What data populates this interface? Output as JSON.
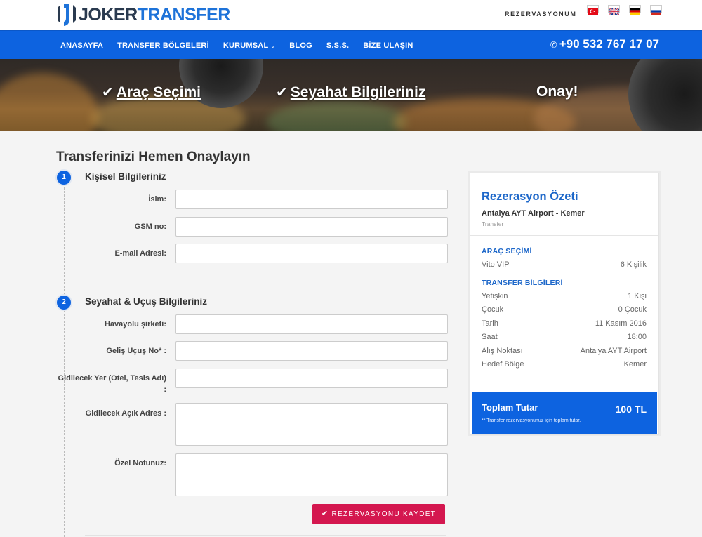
{
  "header": {
    "logo_part1": "JOKER",
    "logo_part2": "TRANSFER",
    "reservation_link": "REZERVASYONUM",
    "flags": [
      "turkish-flag-icon",
      "uk-flag-icon",
      "german-flag-icon",
      "russian-flag-icon"
    ]
  },
  "nav": {
    "items": [
      {
        "label": "ANASAYFA"
      },
      {
        "label": "TRANSFER BÖLGELERİ"
      },
      {
        "label": "KURUMSAL",
        "dropdown": true
      },
      {
        "label": "BLOG"
      },
      {
        "label": "S.S.S."
      },
      {
        "label": "BİZE ULAŞIN"
      }
    ],
    "phone": "+90 532 767 17 07"
  },
  "steps": [
    {
      "label": "Araç Seçimi",
      "done": true
    },
    {
      "label": "Seyahat Bilgileriniz",
      "done": true
    },
    {
      "label": "Onay!",
      "done": false
    }
  ],
  "form": {
    "title": "Transferinizi Hemen Onaylayın",
    "section1": {
      "num": "1",
      "title": "Kişisel Bilgileriniz",
      "fields": [
        {
          "label": "İsim:",
          "value": ""
        },
        {
          "label": "GSM no:",
          "value": ""
        },
        {
          "label": "E-mail Adresi:",
          "value": ""
        }
      ]
    },
    "section2": {
      "num": "2",
      "title": "Seyahat & Uçuş Bilgileriniz",
      "fields": [
        {
          "label": "Havayolu şirketi:",
          "value": ""
        },
        {
          "label": "Geliş Uçuş No* :",
          "value": ""
        },
        {
          "label": "Gidilecek Yer (Otel, Tesis Adı) :",
          "value": ""
        },
        {
          "label": "Gidilecek Açık Adres :",
          "value": ""
        },
        {
          "label": "Özel Notunuz:",
          "value": ""
        }
      ]
    },
    "save_label": "REZERVASYONU KAYDET"
  },
  "summary": {
    "title": "Rezerasyon Özeti",
    "route": "Antalya AYT Airport - Kemer",
    "type": "Transfer",
    "vehicle_heading": "ARAÇ SEÇİMİ",
    "vehicle": {
      "name": "Vito VIP",
      "capacity": "6 Kişilik"
    },
    "transfer_heading": "TRANSFER BİLGİLERİ",
    "rows": [
      {
        "label": "Yetişkin",
        "value": "1 Kişi"
      },
      {
        "label": "Çocuk",
        "value": "0 Çocuk"
      },
      {
        "label": "Tarih",
        "value": "11 Kasım 2016"
      },
      {
        "label": "Saat",
        "value": "18:00"
      },
      {
        "label": "Alış Noktası",
        "value": "Antalya AYT Airport"
      },
      {
        "label": "Hedef Bölge",
        "value": "Kemer"
      }
    ],
    "total_label": "Toplam Tutar",
    "total_value": "100 TL",
    "total_note": "** Transfer rezervasyonunuz için toplam tutar."
  },
  "colors": {
    "brand_blue": "#0d63e0",
    "accent_red": "#d4174f",
    "logo_dark": "#2a3a4f"
  }
}
